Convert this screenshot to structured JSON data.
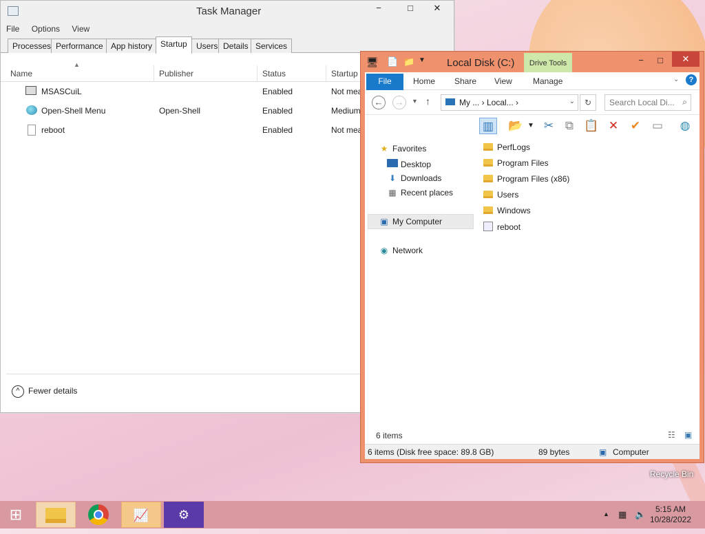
{
  "task_manager": {
    "title": "Task Manager",
    "menu": [
      "File",
      "Options",
      "View"
    ],
    "tabs": [
      "Processes",
      "Performance",
      "App history",
      "Startup",
      "Users",
      "Details",
      "Services"
    ],
    "active_tab": "Startup",
    "columns": [
      "Name",
      "Publisher",
      "Status",
      "Startup i"
    ],
    "rows": [
      {
        "name": "MSASCuiL",
        "publisher": "",
        "status": "Enabled",
        "impact": "Not mea"
      },
      {
        "name": "Open-Shell Menu",
        "publisher": "Open-Shell",
        "status": "Enabled",
        "impact": "Medium"
      },
      {
        "name": "reboot",
        "publisher": "",
        "status": "Enabled",
        "impact": "Not mea"
      }
    ],
    "fewer_details": "Fewer details",
    "window_buttons": {
      "minimize": "−",
      "maximize": "□",
      "close": "✕"
    }
  },
  "explorer": {
    "title": "Local Disk (C:)",
    "drive_tools": "Drive Tools",
    "ribbon_tabs": {
      "file": "File",
      "home": "Home",
      "share": "Share",
      "view": "View",
      "manage": "Manage"
    },
    "address": "My ...  ›  Local...  ›",
    "search_placeholder": "Search Local Di...",
    "nav": {
      "favorites": "Favorites",
      "desktop": "Desktop",
      "downloads": "Downloads",
      "recent": "Recent places",
      "my_computer": "My Computer",
      "network": "Network"
    },
    "items": [
      {
        "name": "PerfLogs",
        "type": "folder"
      },
      {
        "name": "Program Files",
        "type": "folder"
      },
      {
        "name": "Program Files (x86)",
        "type": "folder"
      },
      {
        "name": "Users",
        "type": "folder"
      },
      {
        "name": "Windows",
        "type": "folder"
      },
      {
        "name": "reboot",
        "type": "file"
      }
    ],
    "item_count": "6 items",
    "status": {
      "left": "6 items (Disk free space: 89.8 GB)",
      "size": "89 bytes",
      "location": "Computer"
    },
    "window_buttons": {
      "minimize": "−",
      "maximize": "□",
      "close": "✕"
    }
  },
  "desktop": {
    "recycle_bin": "Recycle Bin"
  },
  "taskbar": {
    "time": "5:15 AM",
    "date": "10/28/2022"
  }
}
